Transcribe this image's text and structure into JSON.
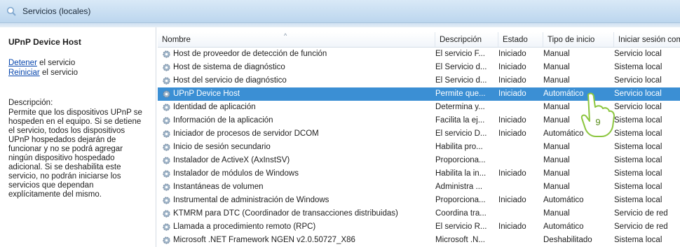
{
  "window": {
    "title": "Servicios (locales)",
    "icon": "search-icon"
  },
  "left_pane": {
    "service_title": "UPnP Device Host",
    "action_stop_link": "Detener",
    "action_stop_rest": " el servicio",
    "action_restart_link": "Reiniciar",
    "action_restart_rest": " el servicio",
    "description_label": "Descripción:",
    "description_lines": [
      "Permite que los dispositivos UPnP se",
      "hospeden en el equipo. Si se detiene",
      "el servicio, todos los dispositivos",
      "UPnP hospedados dejarán de",
      "funcionar y no se podrá agregar",
      "ningún dispositivo hospedado",
      "adicional. Si se deshabilita este",
      "servicio, no podrán iniciarse los",
      "servicios que dependan",
      "explícitamente del mismo."
    ]
  },
  "table": {
    "columns": [
      "Nombre",
      "Descripción",
      "Estado",
      "Tipo de inicio",
      "Iniciar sesión com"
    ],
    "sort_indicator": "^",
    "selected_index": 3,
    "rows": [
      [
        "Host de proveedor de detección de función",
        "El servicio F...",
        "Iniciado",
        "Manual",
        "Servicio local"
      ],
      [
        "Host de sistema de diagnóstico",
        "El Servicio d...",
        "Iniciado",
        "Manual",
        "Sistema local"
      ],
      [
        "Host del servicio de diagnóstico",
        "El Servicio d...",
        "Iniciado",
        "Manual",
        "Servicio local"
      ],
      [
        "UPnP Device Host",
        "Permite que...",
        "Iniciado",
        "Automático",
        "Servicio local"
      ],
      [
        "Identidad de aplicación",
        "Determina y...",
        "",
        "Manual",
        "Servicio local"
      ],
      [
        "Información de la aplicación",
        "Facilita la ej...",
        "Iniciado",
        "Manual",
        "Sistema local"
      ],
      [
        "Iniciador de procesos de servidor DCOM",
        "El servicio D...",
        "Iniciado",
        "Automático",
        "Sistema local"
      ],
      [
        "Inicio de sesión secundario",
        "Habilita pro...",
        "",
        "Manual",
        "Sistema local"
      ],
      [
        "Instalador de ActiveX (AxInstSV)",
        "Proporciona...",
        "",
        "Manual",
        "Sistema local"
      ],
      [
        "Instalador de módulos de Windows",
        "Habilita la in...",
        "Iniciado",
        "Manual",
        "Sistema local"
      ],
      [
        "Instantáneas de volumen",
        "Administra ...",
        "",
        "Manual",
        "Sistema local"
      ],
      [
        "Instrumental de administración de Windows",
        "Proporciona...",
        "Iniciado",
        "Automático",
        "Sistema local"
      ],
      [
        "KTMRM para DTC (Coordinador de transacciones distribuidas)",
        "Coordina tra...",
        "",
        "Manual",
        "Servicio de red"
      ],
      [
        "Llamada a procedimiento remoto (RPC)",
        "El servicio R...",
        "Iniciado",
        "Automático",
        "Servicio de red"
      ],
      [
        "Microsoft .NET Framework NGEN v2.0.50727_X86",
        "Microsoft .N...",
        "",
        "Deshabilitado",
        "Sistema local"
      ]
    ]
  },
  "annotation": {
    "step_number": "9",
    "icon": "hand-pointer-icon"
  },
  "colors": {
    "selection": "#3b8fd4",
    "accent_callout": "#8cc63f",
    "titlebar": "#c9def2"
  }
}
